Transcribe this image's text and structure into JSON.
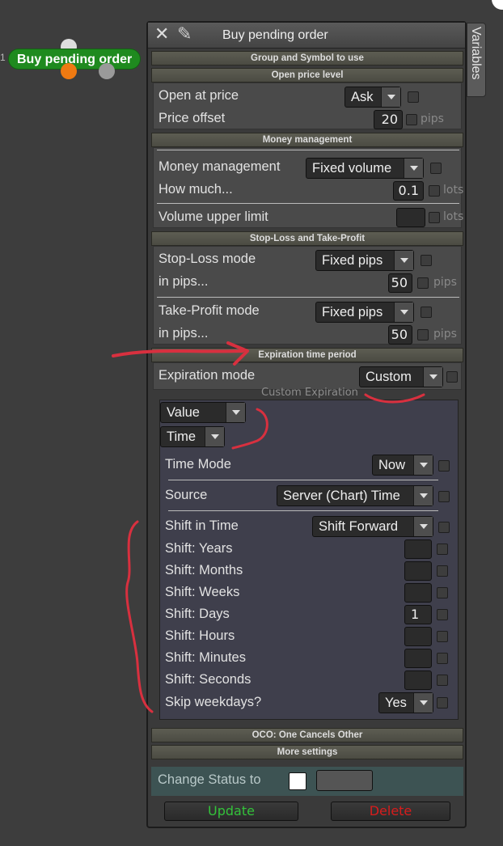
{
  "node": {
    "number": "1",
    "label": "Buy pending order"
  },
  "window": {
    "title": "Buy pending order",
    "side_tab": "Variables",
    "close_icon": "close-icon",
    "pin_icon": "pin-icon"
  },
  "sections": {
    "group_symbol": "Group and Symbol to use",
    "open_price": "Open price level",
    "money": "Money management",
    "sltp": "Stop-Loss and Take-Profit",
    "expiration": "Expiration time period",
    "custom_expiration": "Custom Expiration",
    "oco": "OCO: One Cancels Other",
    "more": "More settings"
  },
  "open_price": {
    "open_at_label": "Open at price",
    "open_at_value": "Ask",
    "offset_label": "Price offset",
    "offset_value": "20",
    "offset_unit": "pips"
  },
  "money": {
    "mm_label": "Money management",
    "mm_value": "Fixed volume",
    "how_label": "How much...",
    "how_value": "0.1",
    "how_unit": "lots",
    "upper_label": "Volume upper limit",
    "upper_value": "",
    "upper_unit": "lots"
  },
  "sltp": {
    "sl_mode_label": "Stop-Loss mode",
    "sl_mode_value": "Fixed pips",
    "sl_pips_label": "in pips...",
    "sl_pips_value": "50",
    "sl_unit": "pips",
    "tp_mode_label": "Take-Profit mode",
    "tp_mode_value": "Fixed pips",
    "tp_pips_label": "in pips...",
    "tp_pips_value": "50",
    "tp_unit": "pips"
  },
  "expiration": {
    "mode_label": "Expiration mode",
    "mode_value": "Custom"
  },
  "custom": {
    "value_type": "Value",
    "time_type": "Time",
    "time_mode_label": "Time Mode",
    "time_mode_value": "Now",
    "source_label": "Source",
    "source_value": "Server (Chart) Time",
    "shift_label": "Shift in Time",
    "shift_value": "Shift Forward",
    "years_label": "Shift: Years",
    "years_value": "",
    "months_label": "Shift: Months",
    "months_value": "",
    "weeks_label": "Shift: Weeks",
    "weeks_value": "",
    "days_label": "Shift: Days",
    "days_value": "1",
    "hours_label": "Shift: Hours",
    "hours_value": "",
    "minutes_label": "Shift: Minutes",
    "minutes_value": "",
    "seconds_label": "Shift: Seconds",
    "seconds_value": "",
    "skip_label": "Skip weekdays?",
    "skip_value": "Yes"
  },
  "footer": {
    "status_label": "Change Status to",
    "update": "Update",
    "delete": "Delete"
  },
  "colors": {
    "node_green": "#1f8a1f",
    "annotation_red": "#d8303f",
    "update_green": "#33c23a",
    "delete_red": "#d81c1c"
  }
}
